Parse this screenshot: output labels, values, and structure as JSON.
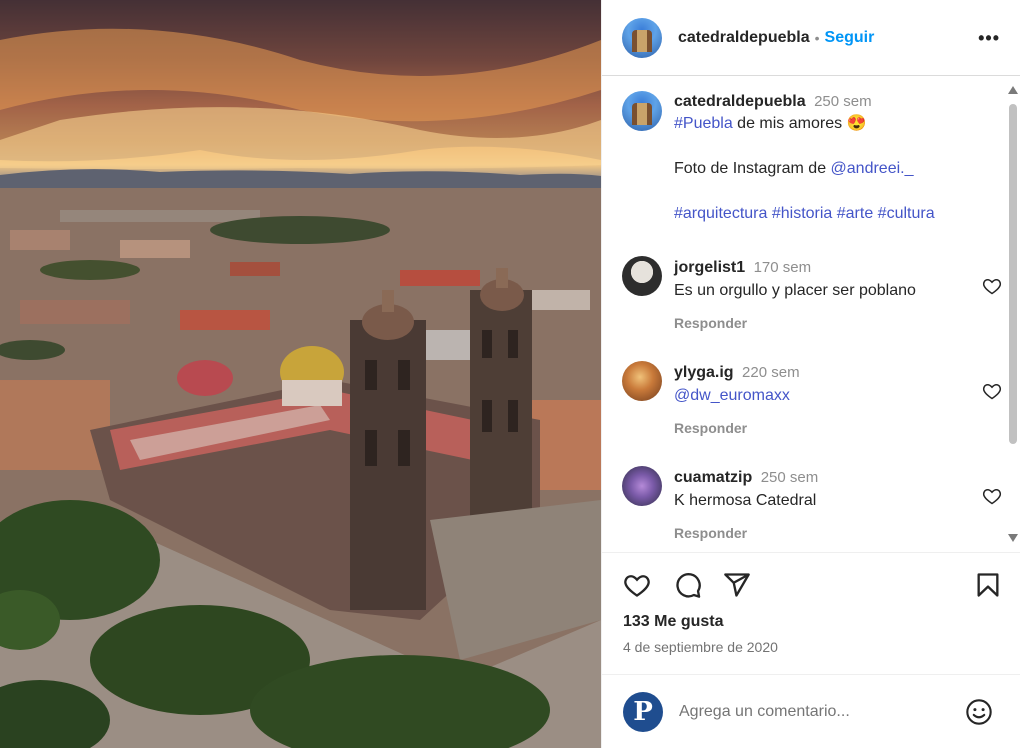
{
  "post": {
    "username": "catedraldepuebla",
    "follow_label": "Seguir",
    "dot": "•",
    "more_label": "•••"
  },
  "caption": {
    "username": "catedraldepuebla",
    "time": "250 sem",
    "hashtag_puebla": "#Puebla",
    "text_1": " de mis amores 😍",
    "text_2": "Foto de Instagram de ",
    "mention": "@andreei._",
    "tags": "#arquitectura #historia #arte #cultura"
  },
  "comments": [
    {
      "username": "jorgelist1",
      "time": "170 sem",
      "text": "Es un orgullo y placer ser poblano",
      "reply": "Responder"
    },
    {
      "username": "ylyga.ig",
      "time": "220 sem",
      "text": "@dw_euromaxx",
      "reply": "Responder"
    },
    {
      "username": "cuamatzip",
      "time": "250 sem",
      "text": "K hermosa Catedral",
      "reply": "Responder"
    }
  ],
  "stats": {
    "likes": "133 Me gusta",
    "date": "4 de septiembre de 2020"
  },
  "add_comment": {
    "placeholder": "Agrega un comentario...",
    "avatar_letter": "P"
  },
  "icons": {
    "like": "heart-icon",
    "comment": "comment-icon",
    "share": "share-icon",
    "save": "bookmark-icon",
    "emoji": "emoji-icon"
  },
  "colors": {
    "link": "#4455c8",
    "follow": "#0095f6",
    "muted": "#8e8e8e"
  }
}
